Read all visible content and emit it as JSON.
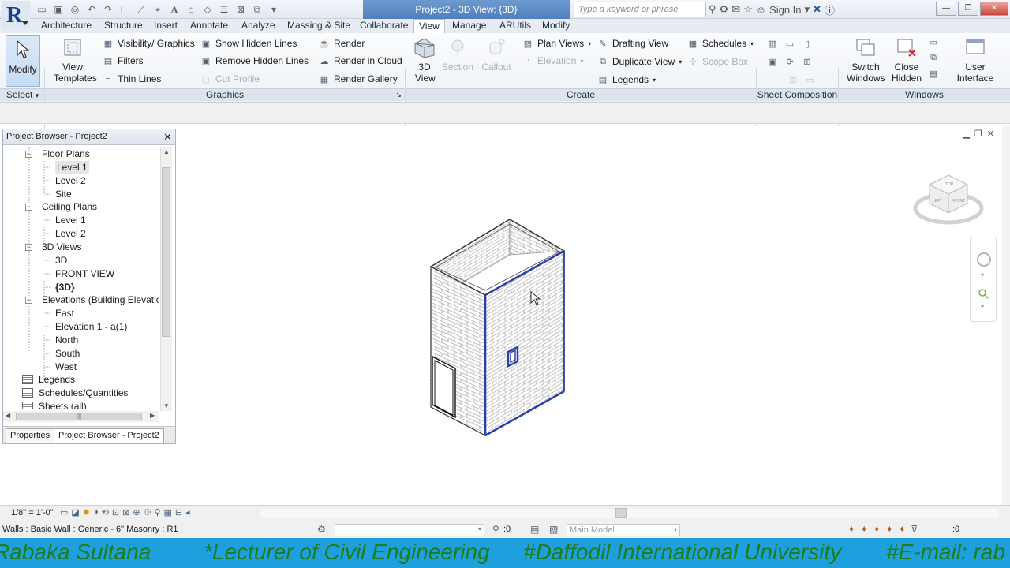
{
  "app": {
    "title": "Project2 - 3D View: {3D}",
    "search_placeholder": "Type a keyword or phrase",
    "sign_in": "Sign In"
  },
  "tabs": [
    "Architecture",
    "Structure",
    "Insert",
    "Annotate",
    "Analyze",
    "Massing & Site",
    "Collaborate",
    "View",
    "Manage",
    "ARUtils",
    "Modify"
  ],
  "active_tab": "View",
  "ribbon": {
    "modify": "Modify",
    "select": "Select",
    "view_templates": "View Templates",
    "visibility_graphics": "Visibility/ Graphics",
    "filters": "Filters",
    "thin_lines": "Thin Lines",
    "show_hidden_lines": "Show Hidden Lines",
    "remove_hidden_lines": "Remove Hidden Lines",
    "cut_profile": "Cut Profile",
    "render": "Render",
    "render_in_cloud": "Render in Cloud",
    "render_gallery": "Render Gallery",
    "view_3d": "3D View",
    "section": "Section",
    "callout": "Callout",
    "plan_views": "Plan Views",
    "elevation": "Elevation",
    "drafting_view": "Drafting View",
    "duplicate_view": "Duplicate View",
    "legends": "Legends",
    "schedules": "Schedules",
    "scope_box": "Scope Box",
    "switch_windows": "Switch Windows",
    "close_hidden": "Close Hidden",
    "user_interface": "User Interface",
    "panels": {
      "graphics": "Graphics",
      "create": "Create",
      "sheet_composition": "Sheet Composition",
      "windows": "Windows"
    }
  },
  "project_browser": {
    "title": "Project Browser - Project2",
    "nodes": [
      {
        "label": "Floor Plans",
        "level": 1,
        "toggle": "−"
      },
      {
        "label": "Level 1",
        "level": 2,
        "selected": true
      },
      {
        "label": "Level 2",
        "level": 2
      },
      {
        "label": "Site",
        "level": 2
      },
      {
        "label": "Ceiling Plans",
        "level": 1,
        "toggle": "−"
      },
      {
        "label": "Level 1",
        "level": 2
      },
      {
        "label": "Level 2",
        "level": 2
      },
      {
        "label": "3D Views",
        "level": 1,
        "toggle": "−"
      },
      {
        "label": "3D",
        "level": 2
      },
      {
        "label": "FRONT VIEW",
        "level": 2
      },
      {
        "label": "{3D}",
        "level": 2,
        "bold": true
      },
      {
        "label": "Elevations (Building Elevation",
        "level": 1,
        "toggle": "−"
      },
      {
        "label": "East",
        "level": 2
      },
      {
        "label": "Elevation 1 - a(1)",
        "level": 2
      },
      {
        "label": "North",
        "level": 2
      },
      {
        "label": "South",
        "level": 2
      },
      {
        "label": "West",
        "level": 2
      },
      {
        "label": "Legends",
        "level": 0,
        "icon": true
      },
      {
        "label": "Schedules/Quantities",
        "level": 0,
        "icon": true
      },
      {
        "label": "Sheets (all)",
        "level": 0,
        "icon": true
      }
    ],
    "tabs": [
      "Properties",
      "Project Browser - Project2"
    ]
  },
  "view_control": {
    "scale": "1/8\" = 1'-0\""
  },
  "status": {
    "selection": "Walls : Basic Wall : Generic - 6\" Masonry : R1",
    "count_a": ":0",
    "count_b": ":0",
    "model": "Main Model"
  },
  "banner": {
    "items": [
      "Rabaka Sultana",
      "*Lecturer of Civil Engineering",
      "#Daffodil International University",
      "#E-mail: rab"
    ]
  },
  "colors": {
    "accent": "#4f7fbd",
    "banner_bg": "#1ea0df",
    "banner_text": "#1e7d1e",
    "wall_edge": "#2a3fa8"
  }
}
